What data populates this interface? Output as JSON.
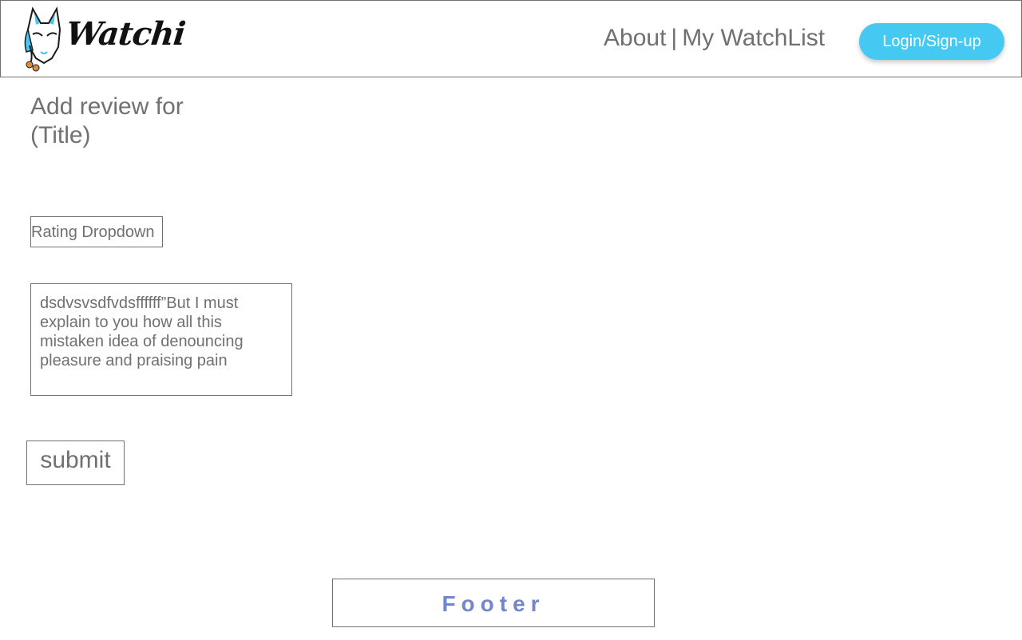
{
  "header": {
    "logo_text": "Watchi",
    "nav": {
      "about": "About",
      "separator": "|",
      "watchlist": "My WatchList"
    },
    "login_label": "Login/Sign-up"
  },
  "main": {
    "title": "Add review for (Title)",
    "rating_label": "Rating Dropdown",
    "review_text": "dsdvsvsdfvdsffffff”But I must explain to you how all this mistaken idea of denouncing pleasure and praising pain",
    "submit_label": "submit"
  },
  "footer": {
    "label": "Footer"
  },
  "colors": {
    "accent": "#45c9f3",
    "text": "#707070",
    "footer_text": "#7286c9",
    "border": "#707070"
  },
  "icons": {
    "logo": "fox-mask-icon"
  }
}
